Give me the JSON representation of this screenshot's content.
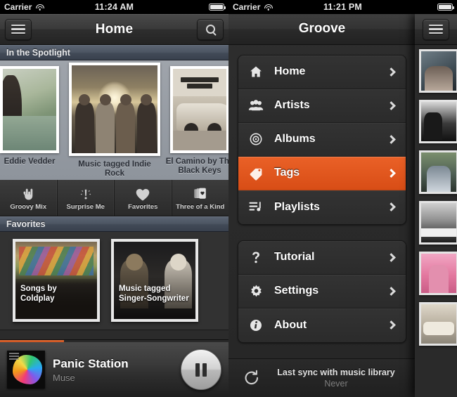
{
  "colors": {
    "accent_orange": "#e2551e",
    "section_header_blue": "#4d5663",
    "nav_dark": "#2e2e2e",
    "background_dark": "#2b2b2b"
  },
  "left_phone": {
    "status_bar": {
      "carrier": "Carrier",
      "wifi_icon": "wifi-icon",
      "time": "11:24 AM",
      "battery_icon": "battery-full-icon"
    },
    "nav": {
      "menu_icon": "hamburger-icon",
      "title": "Home",
      "search_icon": "search-icon"
    },
    "spotlight": {
      "header": "In the Spotlight",
      "cards": [
        {
          "label": "Eddie Vedder",
          "art": "eddie-vedder-album-art"
        },
        {
          "label": "Music tagged Indie Rock",
          "art": "indie-rock-album-art"
        },
        {
          "label": "El Camino by The Black Keys",
          "art": "el-camino-album-art"
        }
      ]
    },
    "quick_actions": [
      {
        "label": "Groovy Mix",
        "icon": "rock-hand-icon"
      },
      {
        "label": "Surprise Me",
        "icon": "exclamation-icon"
      },
      {
        "label": "Favorites",
        "icon": "heart-icon"
      },
      {
        "label": "Three of a Kind",
        "icon": "playing-cards-icon"
      }
    ],
    "favorites": {
      "header": "Favorites",
      "cards": [
        {
          "caption": "Songs by Coldplay",
          "art": "coldplay-art"
        },
        {
          "caption": "Music tagged\nSinger-Songwriter",
          "art": "singer-songwriter-art"
        }
      ]
    },
    "now_playing": {
      "title": "Panic Station",
      "artist": "Muse",
      "progress_percent": 28,
      "button_icon": "pause-icon",
      "artwork": "muse-album-art"
    }
  },
  "right_phone": {
    "status_bar": {
      "carrier": "Carrier",
      "wifi_icon": "wifi-icon",
      "time": "11:21 PM",
      "battery_icon": "battery-full-icon"
    },
    "drawer": {
      "title": "Groove",
      "groups": [
        {
          "items": [
            {
              "label": "Home",
              "icon": "home-icon",
              "active": false
            },
            {
              "label": "Artists",
              "icon": "people-icon",
              "active": false
            },
            {
              "label": "Albums",
              "icon": "disc-icon",
              "active": false
            },
            {
              "label": "Tags",
              "icon": "tag-icon",
              "active": true
            },
            {
              "label": "Playlists",
              "icon": "playlist-icon",
              "active": false
            }
          ]
        },
        {
          "items": [
            {
              "label": "Tutorial",
              "icon": "question-mark-icon",
              "active": false
            },
            {
              "label": "Settings",
              "icon": "gear-icon",
              "active": false
            },
            {
              "label": "About",
              "icon": "info-icon",
              "active": false
            }
          ]
        }
      ],
      "sync": {
        "icon": "refresh-icon",
        "line1": "Last sync with music library",
        "line2": "Never"
      }
    },
    "content_pane": {
      "menu_icon": "hamburger-icon",
      "thumbnails": [
        {
          "art": "thumb-1"
        },
        {
          "art": "thumb-2"
        },
        {
          "art": "thumb-3"
        },
        {
          "art": "thumb-4"
        },
        {
          "art": "thumb-5"
        },
        {
          "art": "thumb-6"
        }
      ]
    }
  }
}
